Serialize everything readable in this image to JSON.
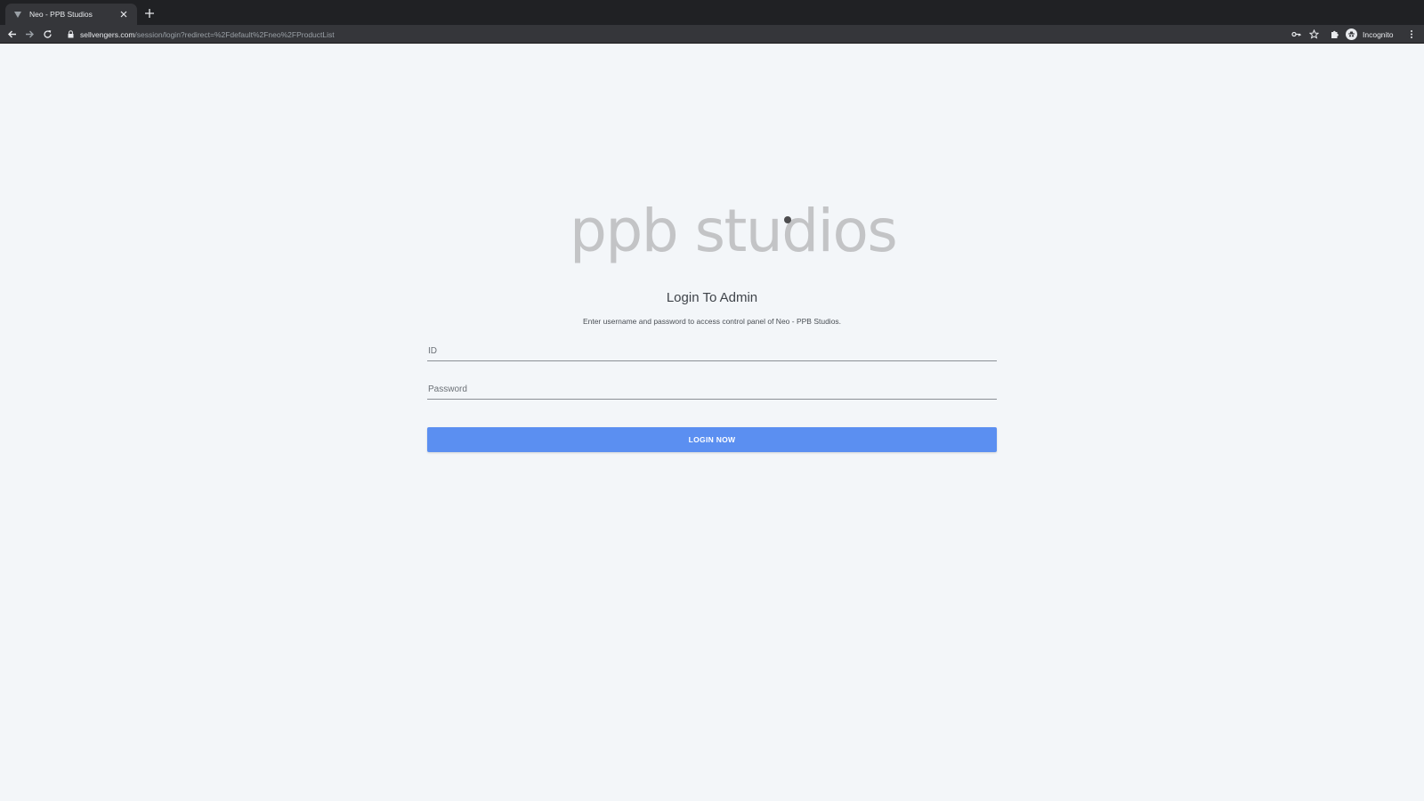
{
  "browser": {
    "tab_title": "Neo - PPB Studios",
    "url_host": "sellvengers.com",
    "url_path": "/session/login?redirect=%2Fdefault%2Fneo%2FProductList",
    "profile_label": "Incognito",
    "icons": [
      "favicon-icon",
      "close-icon",
      "new-tab-icon",
      "back-icon",
      "forward-icon",
      "reload-icon",
      "lock-icon",
      "key-icon",
      "star-icon",
      "extensions-icon",
      "incognito-icon",
      "more-icon"
    ]
  },
  "page": {
    "logo_text": "ppb studios",
    "title": "Login To Admin",
    "subtitle": "Enter username and password to access control panel of Neo - PPB Studios.",
    "id_placeholder": "ID",
    "id_value": "",
    "password_placeholder": "Password",
    "password_value": "",
    "login_button_label": "LOGIN NOW",
    "accent_color": "#5b8ff1",
    "background_color": "#f3f6f9"
  }
}
